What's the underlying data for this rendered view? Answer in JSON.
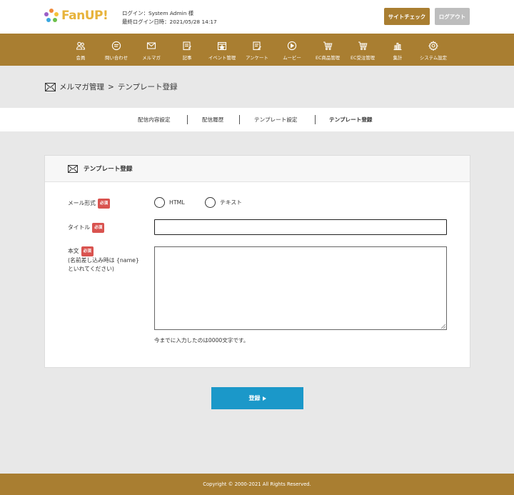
{
  "header": {
    "logo_text": "FanUP!",
    "login_user": "ログイン：System Admin 様",
    "last_login": "最終ログイン日時：2021/05/28 14:17",
    "site_check_label": "サイトチェック",
    "logout_label": "ログアウト"
  },
  "nav": {
    "items": [
      {
        "label": "会員",
        "icon": "members-icon"
      },
      {
        "label": "問い合わせ",
        "icon": "inquiry-icon"
      },
      {
        "label": "メルマガ",
        "icon": "mail-icon"
      },
      {
        "label": "記事",
        "icon": "article-icon"
      },
      {
        "label": "イベント管理",
        "icon": "event-icon"
      },
      {
        "label": "アンケート",
        "icon": "survey-icon"
      },
      {
        "label": "ムービー",
        "icon": "movie-icon"
      },
      {
        "label": "EC商品管理",
        "icon": "cart-icon"
      },
      {
        "label": "EC受注管理",
        "icon": "cart-icon"
      },
      {
        "label": "集計",
        "icon": "chart-icon"
      },
      {
        "label": "システム設定",
        "icon": "gear-icon"
      }
    ]
  },
  "breadcrumb": {
    "section": "メルマガ管理",
    "separator": ">",
    "page": "テンプレート登録"
  },
  "subtabs": [
    {
      "label": "配信内容設定",
      "active": false
    },
    {
      "label": "配信履歴",
      "active": false
    },
    {
      "label": "テンプレート設定",
      "active": false
    },
    {
      "label": "テンプレート登録",
      "active": true
    }
  ],
  "form": {
    "panel_title": "テンプレート登録",
    "required_badge": "必須",
    "mail_format_label": "メール形式",
    "mail_format_options": [
      "HTML",
      "テキスト"
    ],
    "title_label": "タイトル",
    "title_value": "",
    "body_label": "本文",
    "body_note_1": "(名前差し込み時は {name}",
    "body_note_2": "といれてください)",
    "body_value": "",
    "counter_text": "今までに入力したのは0000文字です。",
    "submit_label": "登録"
  },
  "footer": {
    "copyright": "Copyright © 2000-2021 All Rights Reserved."
  },
  "colors": {
    "brand": "#a97e31",
    "submit": "#1b98c9",
    "required": "#d9534f"
  }
}
